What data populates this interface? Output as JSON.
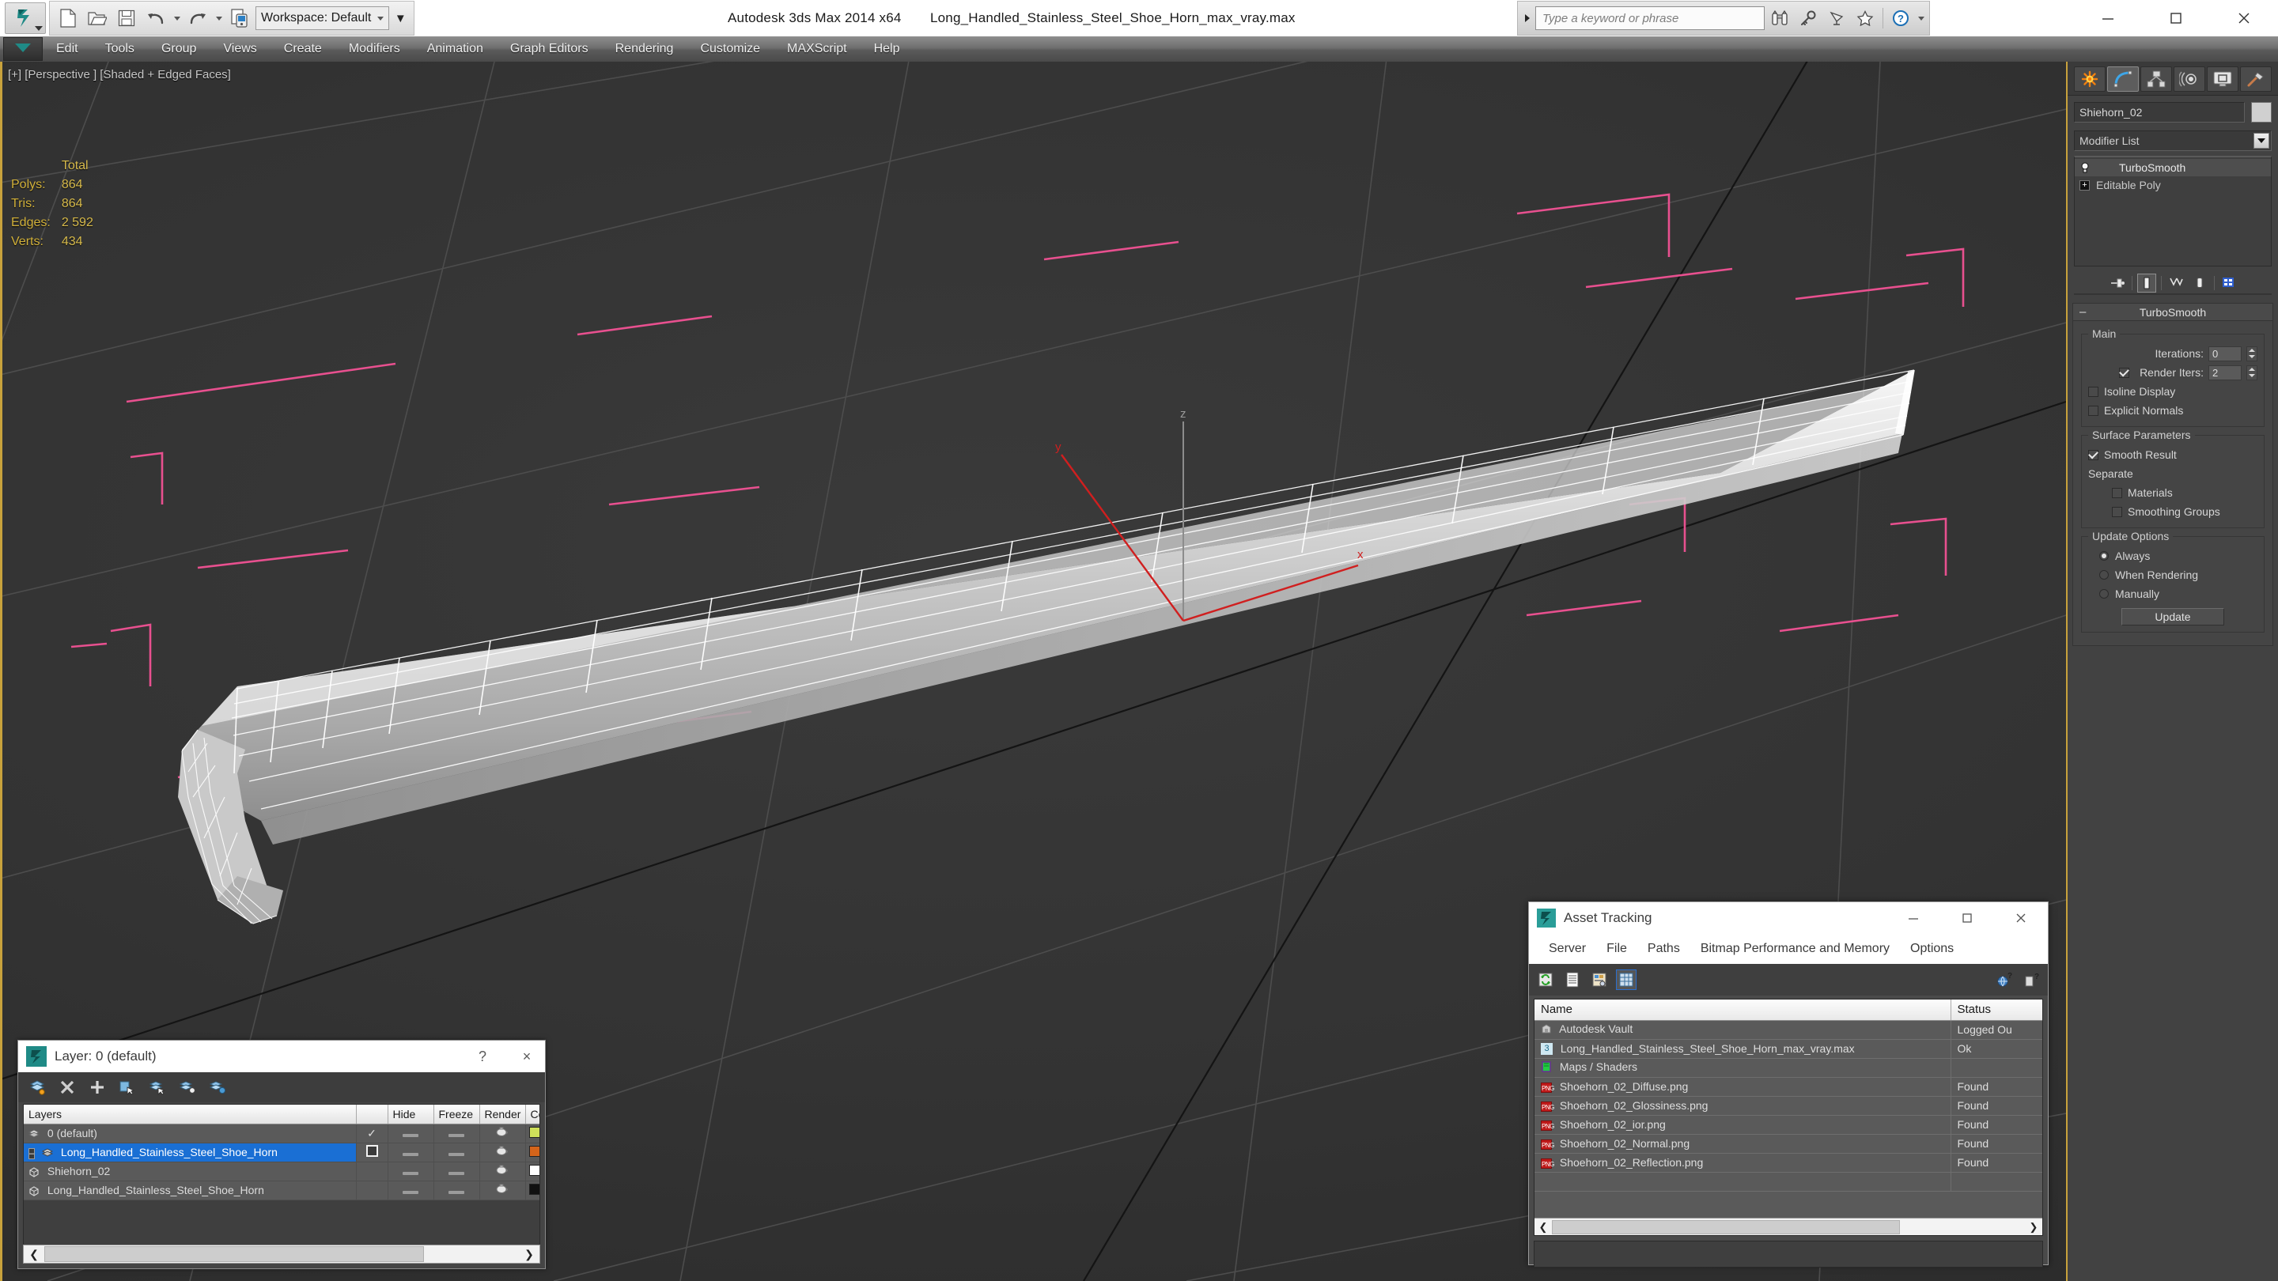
{
  "titlebar": {
    "app_name": "Autodesk 3ds Max  2014 x64",
    "document_name": "Long_Handled_Stainless_Steel_Shoe_Horn_max_vray.max",
    "workspace_label": "Workspace: Default",
    "search_placeholder": "Type a keyword or phrase",
    "quick_access": [
      {
        "name": "new-file-icon",
        "label": "New"
      },
      {
        "name": "open-file-icon",
        "label": "Open"
      },
      {
        "name": "save-file-icon",
        "label": "Save"
      },
      {
        "name": "undo-icon",
        "label": "Undo"
      },
      {
        "name": "redo-icon",
        "label": "Redo"
      },
      {
        "name": "project-folder-icon",
        "label": "Set Project Folder"
      }
    ],
    "infocenter_buttons": [
      {
        "name": "search-binoculars-icon",
        "label": "Search"
      },
      {
        "name": "subscription-key-icon",
        "label": "Subscription Center"
      },
      {
        "name": "communication-center-icon",
        "label": "Communication Center"
      },
      {
        "name": "favorites-star-icon",
        "label": "Favorites"
      },
      {
        "name": "help-icon",
        "label": "Help"
      }
    ],
    "window_buttons": [
      {
        "name": "minimize-button",
        "glyph": "minimize"
      },
      {
        "name": "maximize-button",
        "glyph": "maximize"
      },
      {
        "name": "close-button",
        "glyph": "close"
      }
    ]
  },
  "menubar": {
    "items": [
      "Edit",
      "Tools",
      "Group",
      "Views",
      "Create",
      "Modifiers",
      "Animation",
      "Graph Editors",
      "Rendering",
      "Customize",
      "MAXScript",
      "Help"
    ]
  },
  "viewport": {
    "label": "[+] [Perspective ] [Shaded + Edged Faces]",
    "stats": {
      "header": "Total",
      "rows": [
        {
          "label": "Polys:",
          "value": "864"
        },
        {
          "label": "Tris:",
          "value": "864"
        },
        {
          "label": "Edges:",
          "value": "2 592"
        },
        {
          "label": "Verts:",
          "value": "434"
        }
      ]
    },
    "axis_labels": {
      "x": "x",
      "y": "y",
      "z": "z"
    },
    "colors": {
      "background": "#333333",
      "mesh": "#e8e8e8",
      "wireframe": "#ffffff",
      "selection_bbox": "#e8508f",
      "grid": "#4a4a4a",
      "axis_x": "#d01f1f",
      "stats_text": "#d2b13a",
      "viewport_border": "#c8a23c"
    }
  },
  "command_panel": {
    "tabs": [
      {
        "name": "create-tab",
        "label": "Create"
      },
      {
        "name": "modify-tab",
        "label": "Modify",
        "active": true
      },
      {
        "name": "hierarchy-tab",
        "label": "Hierarchy"
      },
      {
        "name": "motion-tab",
        "label": "Motion"
      },
      {
        "name": "display-tab",
        "label": "Display"
      },
      {
        "name": "utilities-tab",
        "label": "Utilities"
      }
    ],
    "object_name": "Shiehorn_02",
    "modifier_list_label": "Modifier List",
    "modifier_stack": [
      {
        "label": "TurboSmooth",
        "selected": true
      },
      {
        "label": "Editable Poly",
        "selected": false
      }
    ],
    "stack_tools": [
      {
        "name": "pin-stack-icon"
      },
      {
        "name": "show-end-result-icon"
      },
      {
        "name": "make-unique-icon"
      },
      {
        "name": "remove-modifier-icon"
      },
      {
        "name": "configure-modifier-sets-icon"
      }
    ],
    "turbosmooth": {
      "rollout_title": "TurboSmooth",
      "main_label": "Main",
      "iterations_label": "Iterations:",
      "iterations_value": "0",
      "render_iters_label": "Render Iters:",
      "render_iters_value": "2",
      "render_iters_checked": true,
      "isoline_display_label": "Isoline Display",
      "isoline_display_checked": false,
      "explicit_normals_label": "Explicit Normals",
      "explicit_normals_checked": false,
      "surface_parameters_label": "Surface Parameters",
      "smooth_result_label": "Smooth Result",
      "smooth_result_checked": true,
      "separate_label": "Separate",
      "materials_label": "Materials",
      "materials_checked": false,
      "smoothing_groups_label": "Smoothing Groups",
      "smoothing_groups_checked": false,
      "update_options_label": "Update Options",
      "update_always_label": "Always",
      "update_when_rendering_label": "When Rendering",
      "update_manually_label": "Manually",
      "update_selected": "Always",
      "update_button_label": "Update"
    }
  },
  "layer_dialog": {
    "title": "Layer: 0 (default)",
    "help_glyph": "?",
    "close_glyph": "×",
    "toolbar": [
      {
        "name": "create-new-layer-icon"
      },
      {
        "name": "delete-layer-icon"
      },
      {
        "name": "add-selection-to-layer-icon"
      },
      {
        "name": "select-objects-in-layer-icon"
      },
      {
        "name": "select-highlighted-objects-icon"
      },
      {
        "name": "highlight-selected-objects-icon"
      },
      {
        "name": "layer-properties-icon"
      }
    ],
    "columns": [
      "Layers",
      "",
      "Hide",
      "Freeze",
      "Render",
      "Co"
    ],
    "rows": [
      {
        "name": "0 (default)",
        "indent": 1,
        "icon": "layer-icon",
        "current": true,
        "selected": false,
        "color": "#cfe05a"
      },
      {
        "name": "Long_Handled_Stainless_Steel_Shoe_Horn",
        "indent": 0,
        "icon": "layer-icon",
        "current": false,
        "selected": true,
        "expanded": true,
        "color": "#d4641a"
      },
      {
        "name": "Shiehorn_02",
        "indent": 2,
        "icon": "object-icon",
        "current": false,
        "selected": false,
        "color": "#ffffff"
      },
      {
        "name": "Long_Handled_Stainless_Steel_Shoe_Horn",
        "indent": 2,
        "icon": "object-icon",
        "current": false,
        "selected": false,
        "color": "#111111"
      }
    ]
  },
  "asset_tracking": {
    "title": "Asset Tracking",
    "menus": [
      "Server",
      "File",
      "Paths",
      "Bitmap Performance and Memory",
      "Options"
    ],
    "toolbar": [
      {
        "name": "refresh-icon"
      },
      {
        "name": "list-view-icon"
      },
      {
        "name": "detail-view-icon"
      },
      {
        "name": "grid-view-icon",
        "active": true
      }
    ],
    "toolbar_right": [
      {
        "name": "help-globe-icon"
      },
      {
        "name": "help-question-icon"
      }
    ],
    "columns": [
      "Name",
      "Status"
    ],
    "rows": [
      {
        "name": "Autodesk Vault",
        "status": "Logged Ou",
        "indent": 1,
        "icon": "vault-icon"
      },
      {
        "name": "Long_Handled_Stainless_Steel_Shoe_Horn_max_vray.max",
        "status": "Ok",
        "indent": 2,
        "icon": "max-file-icon"
      },
      {
        "name": "Maps / Shaders",
        "status": "",
        "indent": 3,
        "icon": "maps-shaders-icon"
      },
      {
        "name": "Shoehorn_02_Diffuse.png",
        "status": "Found",
        "indent": 3,
        "icon": "png-icon"
      },
      {
        "name": "Shoehorn_02_Glossiness.png",
        "status": "Found",
        "indent": 3,
        "icon": "png-icon"
      },
      {
        "name": "Shoehorn_02_ior.png",
        "status": "Found",
        "indent": 3,
        "icon": "png-icon"
      },
      {
        "name": "Shoehorn_02_Normal.png",
        "status": "Found",
        "indent": 3,
        "icon": "png-icon"
      },
      {
        "name": "Shoehorn_02_Reflection.png",
        "status": "Found",
        "indent": 3,
        "icon": "png-icon"
      }
    ]
  }
}
